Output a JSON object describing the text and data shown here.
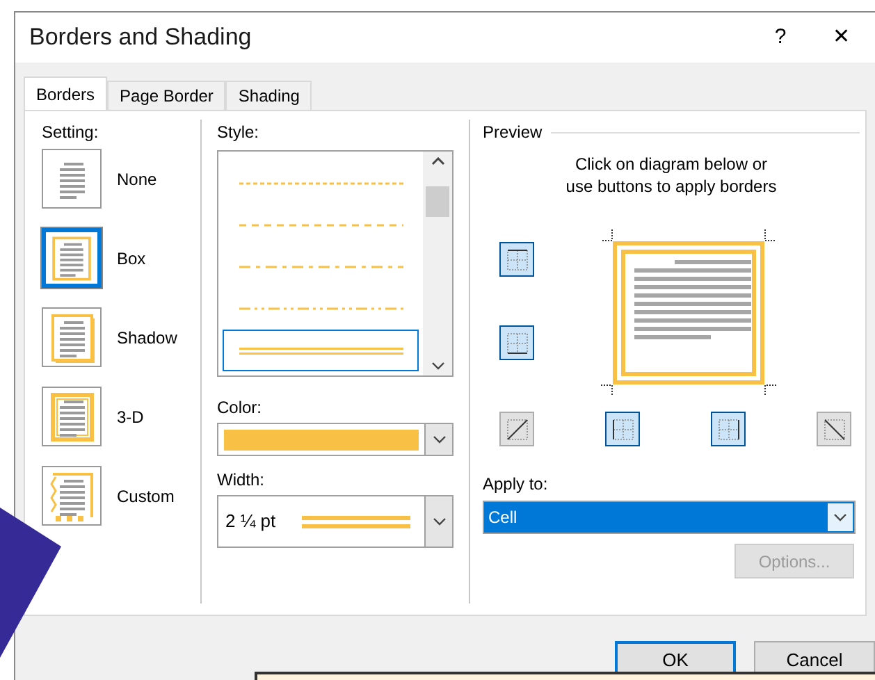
{
  "window": {
    "title": "Borders and Shading",
    "help": "?",
    "close": "✕"
  },
  "tabs": [
    {
      "label": "Borders",
      "selected": true
    },
    {
      "label": "Page Border",
      "selected": false
    },
    {
      "label": "Shading",
      "selected": false
    }
  ],
  "setting": {
    "label": "Setting:",
    "items": [
      {
        "kind": "none",
        "label": "None",
        "selected": false
      },
      {
        "kind": "box",
        "label": "Box",
        "selected": true
      },
      {
        "kind": "shadow",
        "label": "Shadow",
        "selected": false
      },
      {
        "kind": "threed",
        "label": "3-D",
        "selected": false
      },
      {
        "kind": "custom",
        "label": "Custom",
        "selected": false
      }
    ]
  },
  "style": {
    "label": "Style:",
    "items": [
      {
        "kind": "dotted",
        "selected": false
      },
      {
        "kind": "dashed",
        "selected": false
      },
      {
        "kind": "dash-dot",
        "selected": false
      },
      {
        "kind": "dash-dot-dot",
        "selected": false
      },
      {
        "kind": "double",
        "selected": true
      }
    ]
  },
  "color": {
    "label": "Color:",
    "color": "#f8c146"
  },
  "width": {
    "label": "Width:",
    "value": "2 ¼ pt"
  },
  "preview": {
    "label": "Preview",
    "instruction": "Click on diagram below or use buttons to apply borders",
    "side_buttons": [
      {
        "kind": "top",
        "selected": true
      },
      {
        "kind": "bottom",
        "selected": true
      }
    ],
    "bottom_buttons": [
      {
        "kind": "diagonal-up",
        "selected": false
      },
      {
        "kind": "left",
        "selected": true
      },
      {
        "kind": "right",
        "selected": true
      },
      {
        "kind": "diagonal-down",
        "selected": false
      }
    ]
  },
  "apply_to": {
    "label": "Apply to:",
    "value": "Cell"
  },
  "options_button": {
    "label": "Options...",
    "disabled": true
  },
  "buttons": [
    {
      "label": "OK",
      "default": true
    },
    {
      "label": "Cancel",
      "default": false
    }
  ]
}
